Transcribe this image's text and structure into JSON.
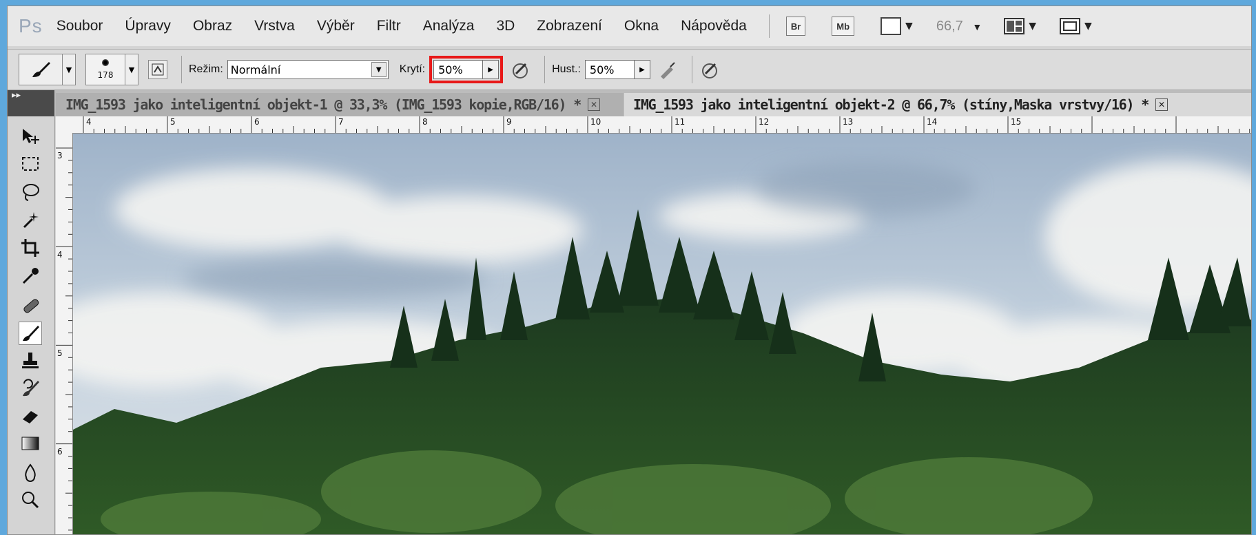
{
  "app": {
    "logo": "Ps"
  },
  "menu": [
    "Soubor",
    "Úpravy",
    "Obraz",
    "Vrstva",
    "Výběr",
    "Filtr",
    "Analýza",
    "3D",
    "Zobrazení",
    "Okna",
    "Nápověda"
  ],
  "menubar_buttons": {
    "bridge": "Br",
    "mini_bridge": "Mb"
  },
  "zoom": "66,7",
  "options": {
    "brush_size": "178",
    "mode_label": "Režim:",
    "mode_value": "Normální",
    "opacity_label": "Krytí:",
    "opacity_value": "50%",
    "flow_label": "Hust.:",
    "flow_value": "50%"
  },
  "tabs": [
    {
      "title": "IMG_1593 jako inteligentní objekt-1 @ 33,3% (IMG_1593 kopie,RGB/16) *",
      "active": false
    },
    {
      "title": "IMG_1593 jako inteligentní objekt-2 @ 66,7% (stíny,Maska vrstvy/16) *",
      "active": true
    }
  ],
  "ruler_top": [
    "4",
    "5",
    "6",
    "7",
    "8",
    "9",
    "10",
    "11",
    "12",
    "13",
    "14",
    "15"
  ],
  "ruler_left": [
    "3",
    "4",
    "5",
    "6"
  ],
  "highlight_color": "#e81919",
  "tools": [
    "move-icon",
    "marquee-icon",
    "lasso-icon",
    "magic-wand-icon",
    "crop-icon",
    "eyedropper-icon",
    "healing-icon",
    "brush-icon",
    "stamp-icon",
    "history-brush-icon",
    "eraser-icon",
    "gradient-icon",
    "blur-icon",
    "dodge-icon"
  ]
}
